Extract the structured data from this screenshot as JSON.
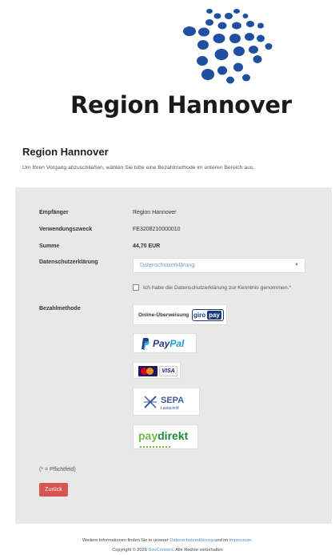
{
  "header": {
    "brand": "Region Hannover"
  },
  "page": {
    "title": "Region Hannover",
    "intro": "Um Ihren Vorgang abzuschließen, wählen Sie bitte eine Bezahlmethode im unteren Bereich aus."
  },
  "form": {
    "recipient_label": "Empfänger",
    "recipient_value": "Region Hannover",
    "purpose_label": "Verwendungszweck",
    "purpose_value": "FE3208210000010",
    "sum_label": "Summe",
    "sum_value": "44,70 EUR",
    "privacy_label": "Datenschutzerklärung",
    "privacy_select_value": "Datenschutzerklärung",
    "consent_text": "Ich habe die Datenschutzerklärung zur Kenntnis genommen.*",
    "payment_label": "Bezahlmethode",
    "required_note": "(* = Pflichtfeld)",
    "back_button": "Zurück"
  },
  "payment_methods": {
    "giropay": {
      "prefix": "Online-Überweisung",
      "brand_a": "giro",
      "brand_b": "pay"
    },
    "paypal": {
      "brand_a": "Pay",
      "brand_b": "Pal"
    },
    "cards": {
      "visa": "VISA"
    },
    "sepa": {
      "title": "SEPA",
      "sub": "Lastschrift"
    },
    "paydirekt": {
      "brand_a": "pay",
      "brand_b": "direkt"
    }
  },
  "footer": {
    "line1_prefix": "Weitere Informationen finden Sie in unserer",
    "line1_link1": "Datenschutzerklärung",
    "line1_mid": "und im",
    "line1_link2": "Impressum",
    "line1_end": ".",
    "line2_prefix": "Copyright © 2021",
    "line2_link": "GovConnect",
    "line2_suffix": ". Alle Rechte vorbehalten"
  },
  "colors": {
    "logo_blue": "#1f4fa0",
    "back_button": "#d9534f",
    "link": "#4a90c8",
    "panel": "#e8e8e8"
  }
}
